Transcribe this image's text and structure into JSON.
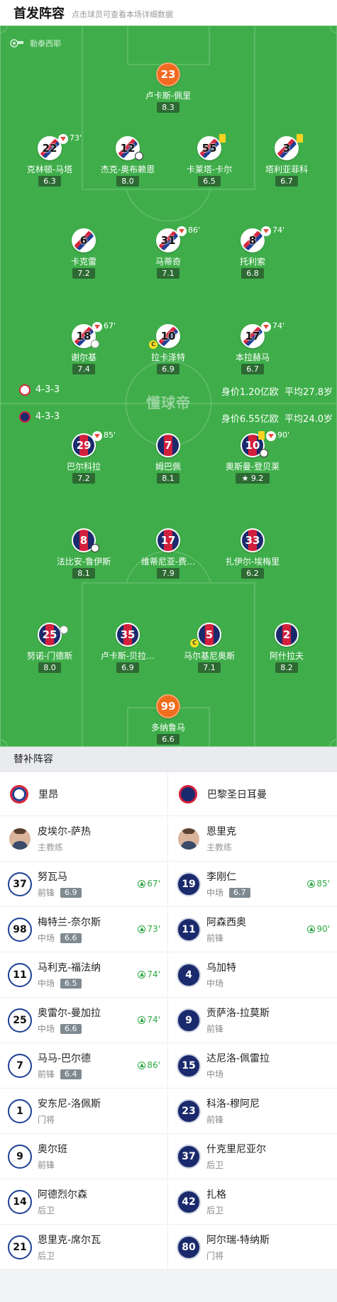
{
  "header": {
    "title": "首发阵容",
    "subtitle": "点击球员可查看本场详细数据"
  },
  "referee": "勒泰西耶",
  "watermark": "懂球帝",
  "lyon": {
    "formation": "4-3-3",
    "value": "身价1.20亿欧",
    "avg_age": "平均27.8岁",
    "players": [
      {
        "num": "23",
        "name": "卢卡斯-佩里",
        "rating": "8.3"
      },
      {
        "num": "22",
        "name": "克林顿-马塔",
        "rating": "6.3",
        "sub_min": "73'"
      },
      {
        "num": "12",
        "name": "杰克-奥布赖恩",
        "rating": "8.0"
      },
      {
        "num": "55",
        "name": "卡莱塔-卡尔",
        "rating": "6.5"
      },
      {
        "num": "3",
        "name": "塔利亚菲科",
        "rating": "6.7"
      },
      {
        "num": "6",
        "name": "卡克雷",
        "rating": "7.2"
      },
      {
        "num": "31",
        "name": "马蒂奇",
        "rating": "7.1",
        "sub_min": "86'"
      },
      {
        "num": "8",
        "name": "托利索",
        "rating": "6.8",
        "sub_min": "74'"
      },
      {
        "num": "18",
        "name": "谢尔基",
        "rating": "7.4",
        "sub_min": "67'"
      },
      {
        "num": "10",
        "name": "拉卡泽特",
        "rating": "6.9",
        "captain": "C"
      },
      {
        "num": "17",
        "name": "本拉赫马",
        "rating": "6.7",
        "sub_min": "74'"
      }
    ]
  },
  "psg": {
    "formation": "4-3-3",
    "value": "身价6.55亿欧",
    "avg_age": "平均24.0岁",
    "players": [
      {
        "num": "29",
        "name": "巴尔科拉",
        "rating": "7.2",
        "sub_min": "85'"
      },
      {
        "num": "7",
        "name": "姆巴佩",
        "rating": "8.1"
      },
      {
        "num": "10",
        "name": "奥斯曼-登贝莱",
        "rating": "9.2",
        "sub_min": "90'"
      },
      {
        "num": "8",
        "name": "法比安-鲁伊斯",
        "rating": "8.1"
      },
      {
        "num": "17",
        "name": "维蒂尼亚-费…",
        "rating": "7.9"
      },
      {
        "num": "33",
        "name": "扎伊尔-埃梅里",
        "rating": "6.2"
      },
      {
        "num": "25",
        "name": "努诺-门德斯",
        "rating": "8.0"
      },
      {
        "num": "35",
        "name": "卢卡斯-贝拉…",
        "rating": "6.9"
      },
      {
        "num": "5",
        "name": "马尔基尼奥斯",
        "rating": "7.1",
        "captain": "C"
      },
      {
        "num": "2",
        "name": "阿什拉夫",
        "rating": "8.2"
      },
      {
        "num": "99",
        "name": "多纳鲁马",
        "rating": "6.6"
      }
    ]
  },
  "subs": {
    "title": "替补阵容",
    "home_team": "里昂",
    "away_team": "巴黎圣日耳曼",
    "home_coach": {
      "name": "皮埃尔-萨热",
      "role": "主教练"
    },
    "away_coach": {
      "name": "恩里克",
      "role": "主教练"
    },
    "home": [
      {
        "num": "37",
        "name": "努瓦马",
        "pos": "前锋",
        "rating": "6.9",
        "in": "67'"
      },
      {
        "num": "98",
        "name": "梅特兰-奈尔斯",
        "pos": "中场",
        "rating": "6.6",
        "in": "73'"
      },
      {
        "num": "11",
        "name": "马利克-福法纳",
        "pos": "中场",
        "rating": "6.5",
        "in": "74'"
      },
      {
        "num": "25",
        "name": "奥雷尔-曼加拉",
        "pos": "中场",
        "rating": "6.6",
        "in": "74'"
      },
      {
        "num": "7",
        "name": "马马-巴尔德",
        "pos": "前锋",
        "rating": "6.4",
        "in": "86'"
      },
      {
        "num": "1",
        "name": "安东尼-洛佩斯",
        "pos": "门将"
      },
      {
        "num": "9",
        "name": "奥尔班",
        "pos": "前锋"
      },
      {
        "num": "14",
        "name": "阿德烈尔森",
        "pos": "后卫"
      },
      {
        "num": "21",
        "name": "恩里克-席尔瓦",
        "pos": "后卫"
      }
    ],
    "away": [
      {
        "num": "19",
        "name": "李刚仁",
        "pos": "中场",
        "rating": "6.7",
        "in": "85'"
      },
      {
        "num": "11",
        "name": "阿森西奥",
        "pos": "前锋",
        "in": "90'"
      },
      {
        "num": "4",
        "name": "乌加特",
        "pos": "中场"
      },
      {
        "num": "9",
        "name": "贡萨洛-拉莫斯",
        "pos": "前锋"
      },
      {
        "num": "15",
        "name": "达尼洛-佩雷拉",
        "pos": "中场"
      },
      {
        "num": "23",
        "name": "科洛-穆阿尼",
        "pos": "前锋"
      },
      {
        "num": "37",
        "name": "什克里尼亚尔",
        "pos": "后卫"
      },
      {
        "num": "42",
        "name": "扎格",
        "pos": "后卫"
      },
      {
        "num": "80",
        "name": "阿尔瑞-特纳斯",
        "pos": "门将"
      }
    ]
  }
}
